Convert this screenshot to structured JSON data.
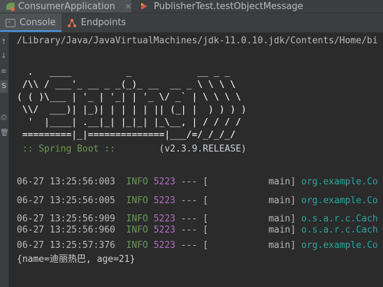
{
  "run_tabs": [
    {
      "label": "ConsumerApplication",
      "active": true
    },
    {
      "label": "PublisherTest.testObjectMessage",
      "active": false
    }
  ],
  "tool_tabs": [
    {
      "label": "Console",
      "active": true
    },
    {
      "label": "Endpoints",
      "active": false
    }
  ],
  "console": {
    "path": "/Library/Java/JavaVirtualMachines/jdk-11.0.10.jdk/Contents/Home/bi",
    "banner": [
      "  .   ____          _            __ _ _",
      " /\\\\ / ___'_ __ _ _(_)_ __  __ _ \\ \\ \\ \\",
      "( ( )\\___ | '_ | '_| | '_ \\/ _` | \\ \\ \\ \\",
      " \\\\/  ___)| |_)| | | | | || (_| |  ) ) ) )",
      "  '  |____| .__|_| |_|_| |_\\__, | / / / /",
      " =========|_|==============|___/=/_/_/_/"
    ],
    "spring_label": " :: Spring Boot ::",
    "spring_version": "(v2.3.9.RELEASE)",
    "logs": [
      {
        "ts": "06-27 13:25:56:003",
        "level": "INFO",
        "pid": "5223",
        "sep": "--- [",
        "thread": "main]",
        "logger": "org.example.Co"
      },
      {
        "ts": "06-27 13:25:56:005",
        "level": "INFO",
        "pid": "5223",
        "sep": "--- [",
        "thread": "main]",
        "logger": "org.example.Co"
      },
      {
        "ts": "06-27 13:25:56:909",
        "level": "INFO",
        "pid": "5223",
        "sep": "--- [",
        "thread": "main]",
        "logger": "o.s.a.r.c.Cach"
      },
      {
        "ts": "06-27 13:25:56:960",
        "level": "INFO",
        "pid": "5223",
        "sep": "--- [",
        "thread": "main]",
        "logger": "o.s.a.r.c.Cach"
      },
      {
        "ts": "06-27 13:25:57:376",
        "level": "INFO",
        "pid": "5223",
        "sep": "--- [",
        "thread": "main]",
        "logger": "org.example.Co"
      }
    ],
    "output": "{name=迪丽热巴, age=21}"
  },
  "gutter": {
    "items": [
      "↑",
      "↓",
      "≡",
      "S",
      "⎙",
      "🗑"
    ]
  },
  "colors": {
    "background": "#2b2b2b",
    "panel": "#3c3f41",
    "info": "#6a9955",
    "pid": "#b070c0",
    "logger": "#2aa7a0"
  }
}
